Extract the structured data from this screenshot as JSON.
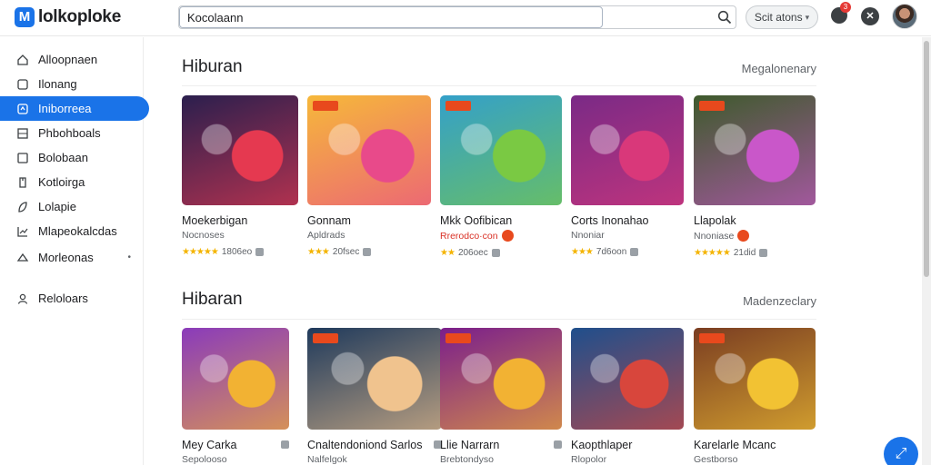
{
  "app": {
    "logo_letter": "M",
    "name": "lolkoploke"
  },
  "search": {
    "value": "Kocolaann"
  },
  "topbar": {
    "settings_label": "Scit atons",
    "notif_count": "3",
    "x_label": "✕"
  },
  "sidebar": {
    "items": [
      {
        "label": "Alloopnaen",
        "icon": "home-icon"
      },
      {
        "label": "Ilonang",
        "icon": "bookmark-icon"
      },
      {
        "label": "Iniborreea",
        "icon": "games-icon",
        "active": true
      },
      {
        "label": "Phbohboals",
        "icon": "grid-icon"
      },
      {
        "label": "Bolobaan",
        "icon": "square-icon"
      },
      {
        "label": "Kotloirga",
        "icon": "tag-icon"
      },
      {
        "label": "Lolapie",
        "icon": "leaf-icon"
      },
      {
        "label": "Mlapeokalcdas",
        "icon": "chart-icon"
      },
      {
        "label": "Morleonas",
        "icon": "puzzle-icon",
        "extra": "•"
      },
      {
        "label": "Reloloars",
        "icon": "user-icon"
      }
    ]
  },
  "sections": [
    {
      "title": "Hiburan",
      "link": "Megalonenary",
      "cards": [
        {
          "title": "Moekerbigan",
          "sub": "Nocnoses",
          "rating": "1806eo",
          "stars": "★★★★★",
          "bg": "#2b1f4e",
          "accent": "#e53950"
        },
        {
          "title": "Gonnam",
          "sub": "Apldrads",
          "rating": "20fsec",
          "stars": "★★★",
          "bg": "#f6b83a",
          "accent": "#e84a8a",
          "badge": true
        },
        {
          "title": "Mkk Oofibican",
          "sub": "Rrerodco·con",
          "rating": "206oec",
          "stars": "★★",
          "bg": "#34a0c9",
          "accent": "#7ac943",
          "badge": true,
          "red": true,
          "hot": true
        },
        {
          "title": "Corts Inonahao",
          "sub": "Nnoniar",
          "rating": "7d6oon",
          "stars": "★★★",
          "bg": "#7a2a86",
          "accent": "#d9387a"
        },
        {
          "title": "Llapolak",
          "sub": "Nnoniase",
          "rating": "21did",
          "stars": "★★★★★",
          "bg": "#3e5a2c",
          "accent": "#c957c9",
          "badge": true,
          "hot": true
        }
      ]
    },
    {
      "title": "Hibaran",
      "link": "Madenzeclary",
      "cards": [
        {
          "title": "Mey Carka",
          "sub": "Sepolooso",
          "bg": "#8a3bbb",
          "accent": "#f2b233",
          "icon_right": true
        },
        {
          "title": "Cnaltendoniond Sarlos",
          "sub": "Nalfelgok",
          "bg": "#1f3a5c",
          "accent": "#f0c38e",
          "badge": true,
          "icon_right": true
        },
        {
          "title": "Llie Narrarn",
          "sub": "Brebtondyso",
          "bg": "#7a1e8c",
          "accent": "#f2b233",
          "badge": true,
          "icon_right": true
        },
        {
          "title": "Kaopthlaper",
          "sub": "Rlopolor",
          "bg": "#1f4f8c",
          "accent": "#d8463c"
        },
        {
          "title": "Karelarle Mcanc",
          "sub": "Gestborso",
          "bg": "#7a3d22",
          "accent": "#f2c233",
          "badge": true
        }
      ]
    }
  ],
  "colors": {
    "accent": "#1a73e8",
    "star": "#f4b400",
    "hot": "#e8491d"
  }
}
